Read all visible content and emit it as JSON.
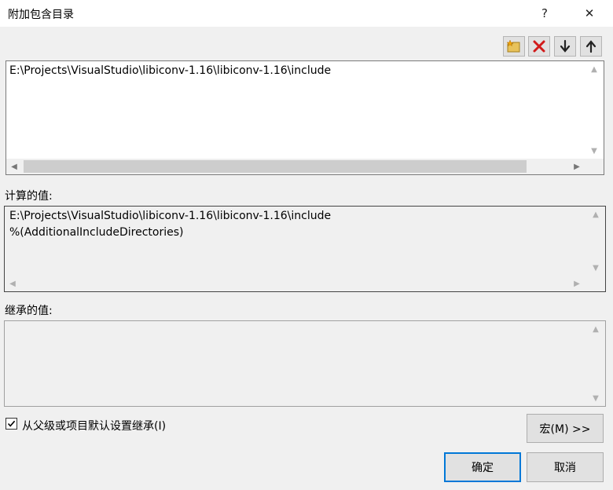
{
  "window": {
    "title": "附加包含目录",
    "help_glyph": "?",
    "close_glyph": "✕"
  },
  "list": {
    "items": [
      "E:\\Projects\\VisualStudio\\libiconv-1.16\\libiconv-1.16\\include"
    ]
  },
  "computed": {
    "label": "计算的值:",
    "lines": [
      "E:\\Projects\\VisualStudio\\libiconv-1.16\\libiconv-1.16\\include",
      "%(AdditionalIncludeDirectories)"
    ]
  },
  "inherited": {
    "label": "继承的值:"
  },
  "inherit_option": {
    "label": "从父级或项目默认设置继承(I)",
    "checked": true
  },
  "buttons": {
    "macros": "宏(M) >>",
    "ok": "确定",
    "cancel": "取消"
  },
  "icons": {
    "new_line": "new-folder-icon",
    "delete": "delete-x-icon",
    "move_down": "arrow-down-icon",
    "move_up": "arrow-up-icon"
  },
  "colors": {
    "accent": "#0078d7",
    "delete_red": "#d11a1a",
    "folder_yellow": "#e8c25a"
  }
}
